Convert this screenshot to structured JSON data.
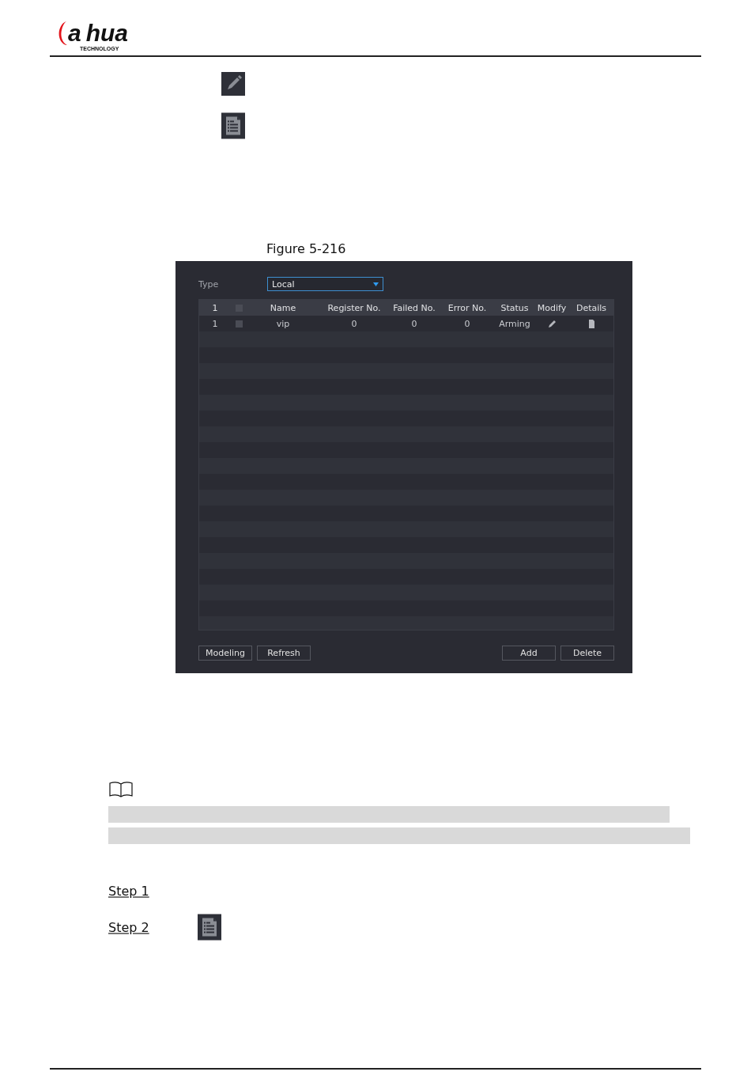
{
  "header": {
    "logo": {
      "mark": "a",
      "word": "hua",
      "tagline": "TECHNOLOGY"
    }
  },
  "figure": {
    "caption": "Figure 5-216",
    "screen": {
      "type_label": "Type",
      "type_value": "Local",
      "table": {
        "columns": [
          {
            "label": "1"
          },
          {
            "kind": "checkbox"
          },
          {
            "label": "Name"
          },
          {
            "label": "Register No."
          },
          {
            "label": "Failed No."
          },
          {
            "label": "Error No."
          },
          {
            "label": "Status"
          },
          {
            "label": "Modify"
          },
          {
            "label": "Details"
          }
        ],
        "header_checked": false,
        "rows": [
          {
            "index": "1",
            "checked": false,
            "name": "vip",
            "register_no": "0",
            "failed_no": "0",
            "error_no": "0",
            "status": "Arming"
          }
        ]
      },
      "buttons_left": [
        "Modeling",
        "Refresh"
      ],
      "buttons_right": [
        "Add",
        "Delete"
      ]
    }
  },
  "steps": [
    {
      "label": "Step 1"
    },
    {
      "label": "Step 2"
    }
  ]
}
